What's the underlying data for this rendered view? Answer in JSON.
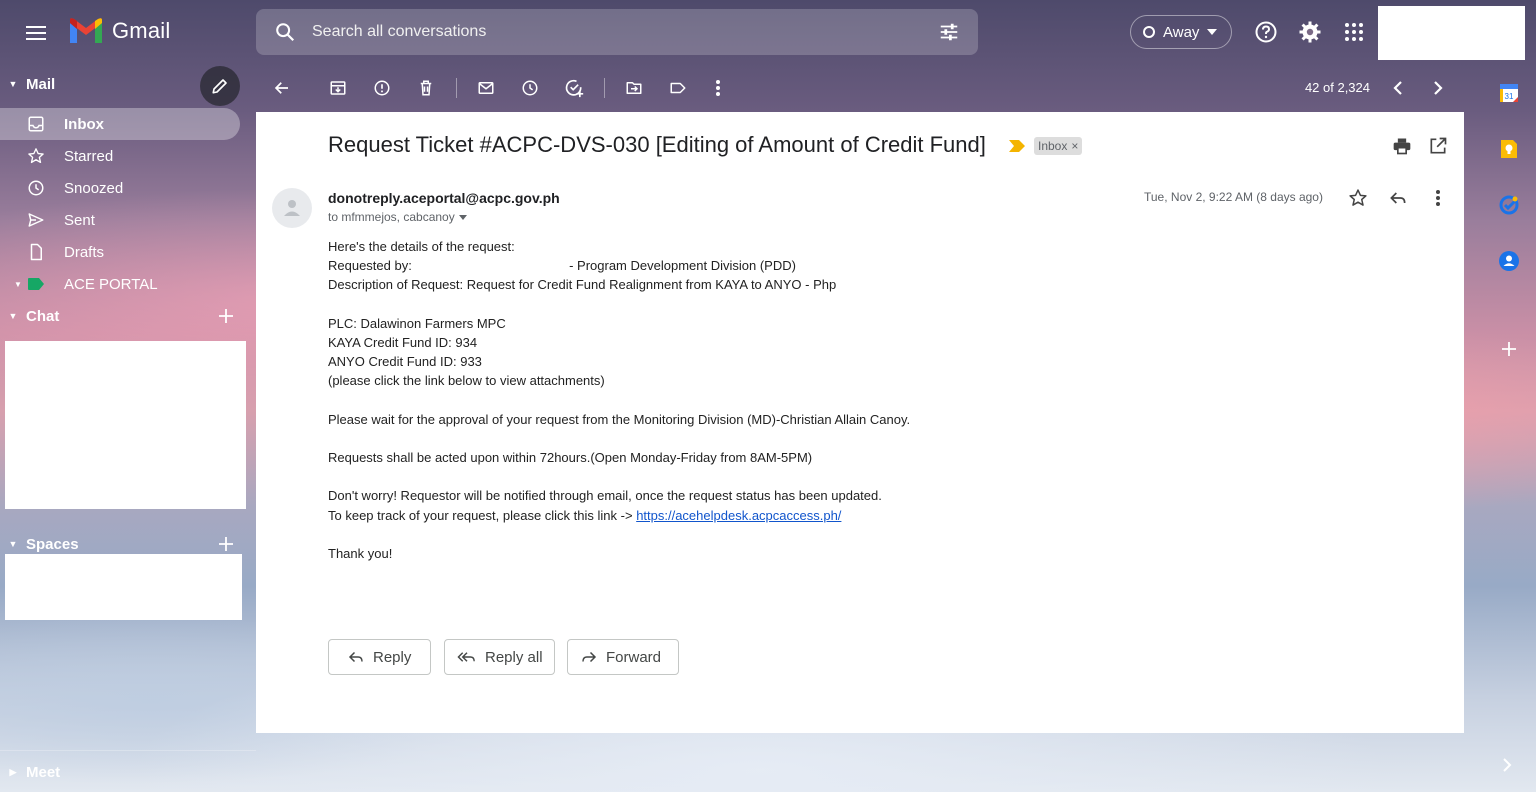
{
  "header": {
    "app_name": "Gmail",
    "search_placeholder": "Search all conversations",
    "status": "Away",
    "colors": {
      "gmail_red": "#EA4335",
      "gmail_blue": "#4285F4",
      "gmail_green": "#34A853",
      "gmail_yellow": "#FBBC04"
    }
  },
  "sidebar": {
    "mail_section": "Mail",
    "items": [
      {
        "label": "Inbox",
        "icon": "inbox-icon",
        "active": true
      },
      {
        "label": "Starred",
        "icon": "star-icon"
      },
      {
        "label": "Snoozed",
        "icon": "clock-icon"
      },
      {
        "label": "Sent",
        "icon": "send-icon"
      },
      {
        "label": "Drafts",
        "icon": "draft-icon"
      },
      {
        "label": "ACE PORTAL",
        "icon": "label-icon",
        "color": "#16a765"
      }
    ],
    "chat_section": "Chat",
    "spaces_section": "Spaces",
    "meet_section": "Meet"
  },
  "toolbar": {
    "pager": "42 of 2,324"
  },
  "email": {
    "subject": "Request Ticket #ACPC-DVS-030 [Editing of Amount of Credit Fund]",
    "label_chip": "Inbox",
    "label_chip_close": "×",
    "sender": "donotreply.aceportal@acpc.gov.ph",
    "to": "to mfmmejos, cabcanoy",
    "date": "Tue, Nov 2, 9:22 AM (8 days ago)",
    "body": {
      "line1": "Here's the details of the request:",
      "requested_by_label": "Requested by:",
      "requested_by_division": "- Program Development Division (PDD)",
      "description": "Description of Request: Request for Credit Fund Realignment from KAYA to ANYO - Php",
      "plc": "PLC: Dalawinon Farmers MPC",
      "kaya": "KAYA Credit Fund ID: 934",
      "anyo": "ANYO Credit Fund ID: 933",
      "attachments_note": "(please click the link below to view attachments)",
      "wait_note": "Please wait for the approval of your request from the Monitoring Division (MD)-Christian Allain Canoy.",
      "sla_note": "Requests shall be acted upon within 72hours.(Open Monday-Friday from 8AM-5PM)",
      "notify_note": "Don't worry! Requestor will be notified through email, once the request status has been updated.",
      "track_note": "To keep track of your request, please click this link ->",
      "link": "https://acehelpdesk.acpcaccess.ph/",
      "thanks": "Thank you!"
    },
    "buttons": {
      "reply": "Reply",
      "reply_all": "Reply all",
      "forward": "Forward"
    }
  }
}
